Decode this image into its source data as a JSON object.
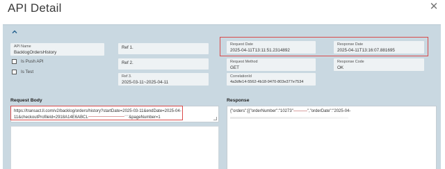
{
  "window": {
    "title": "API Detail",
    "close_icon": "close-icon"
  },
  "panel": {
    "collapse_icon": "chevron-up-icon"
  },
  "fields": {
    "api_name": {
      "label": "API Name",
      "value": "BacklogOrdersHistory"
    },
    "ref1": {
      "label": "Ref 1."
    },
    "ref2": {
      "label": "Ref 2."
    },
    "ref3": {
      "label": "Ref 3.",
      "value": "2025-03-11~2025-04-11"
    },
    "request_date": {
      "label": "Request Date",
      "value": "2025-04-11T13:11:51.2314892"
    },
    "response_date": {
      "label": "Response Date",
      "value": "2025-04-11T13:16:07.881695"
    },
    "request_method": {
      "label": "Request Method",
      "value": "GET"
    },
    "response_code": {
      "label": "Response Code",
      "value": "OK"
    },
    "correlation_id": {
      "label": "CorrelationId",
      "value": "4a3dfe14-5562-4b18-9470-803e377e7534"
    }
  },
  "checkboxes": {
    "is_push_api": {
      "label": "Is Push API",
      "checked": false
    },
    "is_test": {
      "label": "Is Test",
      "checked": false
    }
  },
  "request_body": {
    "label": "Request Body",
    "line1": "https://transact.ll.com/v2/backlog/orders/history?startDate=2025-03-11&endDate=2025-04-",
    "line2_start": "11&checkoutProfileId=2918A14E6ABCL",
    "line2_mid": "\"\"\"",
    "line2_end": "&pageNumber=1"
  },
  "response": {
    "label": "Response",
    "line1_a": "{\"orders\":[{\"orderNumber\":\"10273\"",
    "line1_b": "\",\"orderDate\":\"2025-04-"
  },
  "colors": {
    "panel_bg": "#c9d8e1",
    "field_bg": "#eef2f4",
    "highlight": "#d94a4a",
    "accent": "#1f5e8c"
  }
}
